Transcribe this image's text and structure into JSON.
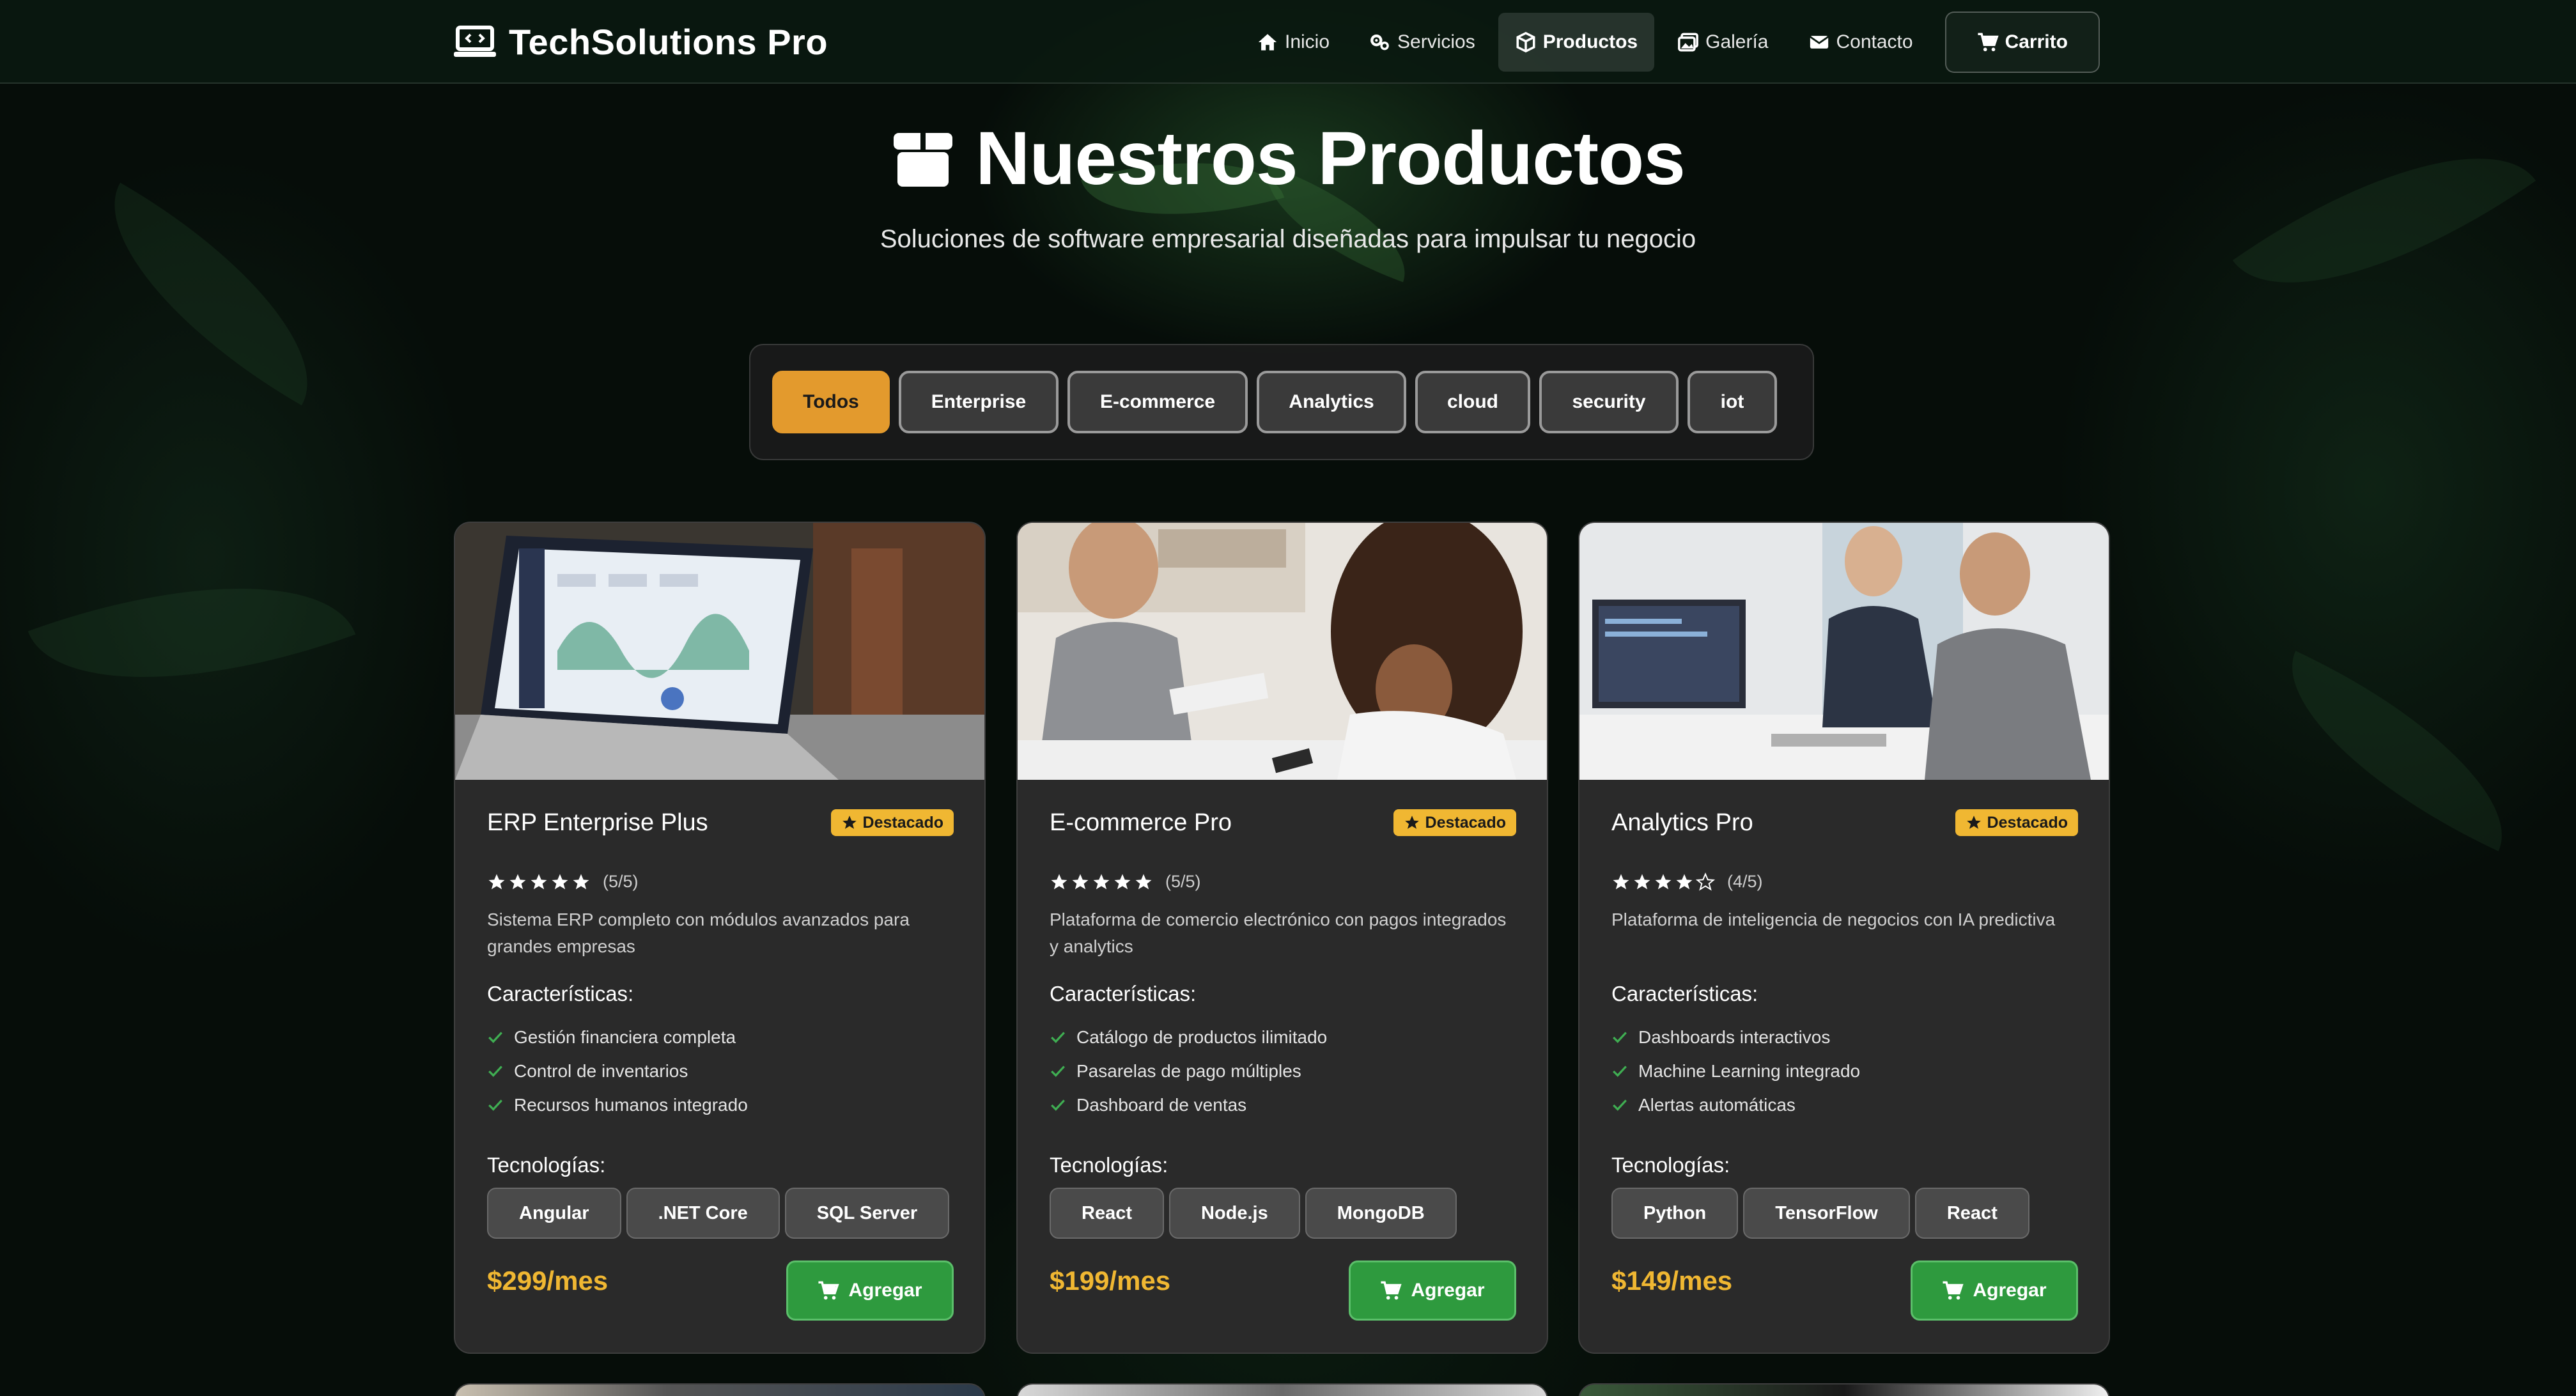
{
  "brand": {
    "name": "TechSolutions Pro",
    "icon": "code-laptop-icon"
  },
  "nav": {
    "items": [
      {
        "label": "Inicio",
        "icon": "home-icon"
      },
      {
        "label": "Servicios",
        "icon": "gears-icon"
      },
      {
        "label": "Productos",
        "icon": "box-icon",
        "active": true
      },
      {
        "label": "Galería",
        "icon": "images-icon"
      },
      {
        "label": "Contacto",
        "icon": "envelope-icon"
      }
    ],
    "cart": {
      "label": "Carrito",
      "icon": "cart-icon"
    }
  },
  "hero": {
    "title": "Nuestros Productos",
    "subtitle": "Soluciones de software empresarial diseñadas para impulsar tu negocio",
    "icon": "box-icon"
  },
  "filters": {
    "active": "Todos",
    "items": [
      "Todos",
      "Enterprise",
      "E-commerce",
      "Analytics",
      "cloud",
      "security",
      "iot"
    ]
  },
  "colors": {
    "accent": "#f0b732",
    "filter_active": "#e39a2d",
    "add_button": "#2e9a3e",
    "card_bg": "#2a2a2a"
  },
  "labels": {
    "featured": "Destacado",
    "features": "Características:",
    "technologies": "Tecnologías:",
    "add": "Agregar"
  },
  "products": [
    {
      "title": "ERP Enterprise Plus",
      "rating": 5,
      "rating_text": "(5/5)",
      "description": "Sistema ERP completo con módulos avanzados para grandes empresas",
      "features": [
        "Gestión financiera completa",
        "Control de inventarios",
        "Recursos humanos integrado"
      ],
      "technologies": [
        "Angular",
        ".NET Core",
        "SQL Server"
      ],
      "price": "$299/mes"
    },
    {
      "title": "E-commerce Pro",
      "rating": 5,
      "rating_text": "(5/5)",
      "description": "Plataforma de comercio electrónico con pagos integrados y analytics",
      "features": [
        "Catálogo de productos ilimitado",
        "Pasarelas de pago múltiples",
        "Dashboard de ventas"
      ],
      "technologies": [
        "React",
        "Node.js",
        "MongoDB"
      ],
      "price": "$199/mes"
    },
    {
      "title": "Analytics Pro",
      "rating": 4,
      "rating_text": "(4/5)",
      "description": "Plataforma de inteligencia de negocios con IA predictiva",
      "features": [
        "Dashboards interactivos",
        "Machine Learning integrado",
        "Alertas automáticas"
      ],
      "technologies": [
        "Python",
        "TensorFlow",
        "React"
      ],
      "price": "$149/mes"
    }
  ]
}
